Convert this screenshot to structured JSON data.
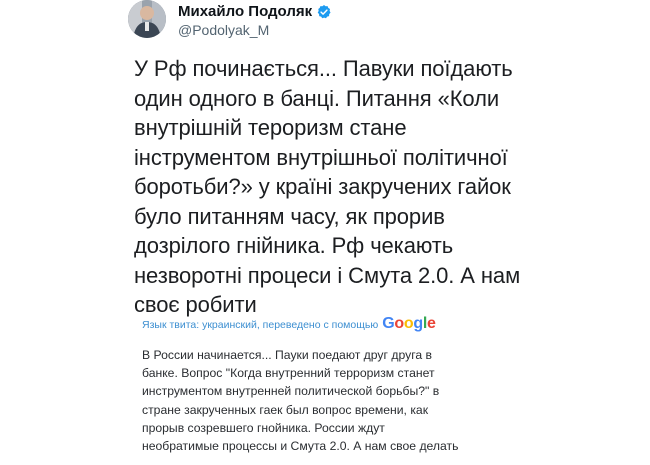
{
  "author": {
    "display_name": "Михайло Подоляк",
    "handle": "@Podolyak_M",
    "verified": true,
    "avatar_icon": "profile-photo",
    "verified_icon": "verified-badge-icon"
  },
  "tweet": {
    "lines": [
      "У Рф починається... Павуки поїдають",
      "один одного в банці. Питання «Коли",
      "внутрішній тероризм стане",
      "інструментом внутрішньої політичної",
      "боротьби?» у країні закручених гайок",
      "було питанням часу, як прорив",
      "дозрілого гнійника. Рф чекають",
      "незворотні процеси і Смута 2.0. А нам",
      "своє робити"
    ]
  },
  "translation": {
    "label": "Язык твита: украинский, переведено с помощью",
    "provider": "Google",
    "lines": [
      "В России начинается... Пауки поедают друг друга в",
      "банке. Вопрос \"Когда внутренний терроризм станет",
      "инструментом внутренней политической борьбы?\" в",
      "стране закрученных гаек был вопрос времени, как",
      "прорыв созревшего гнойника. России ждут",
      "необратимые процессы и Смута 2.0. А нам свое делать"
    ]
  },
  "colors": {
    "text": "#0f1419",
    "secondary": "#536471",
    "translate_link": "#3d8fd1",
    "verified": "#1d9bf0"
  }
}
